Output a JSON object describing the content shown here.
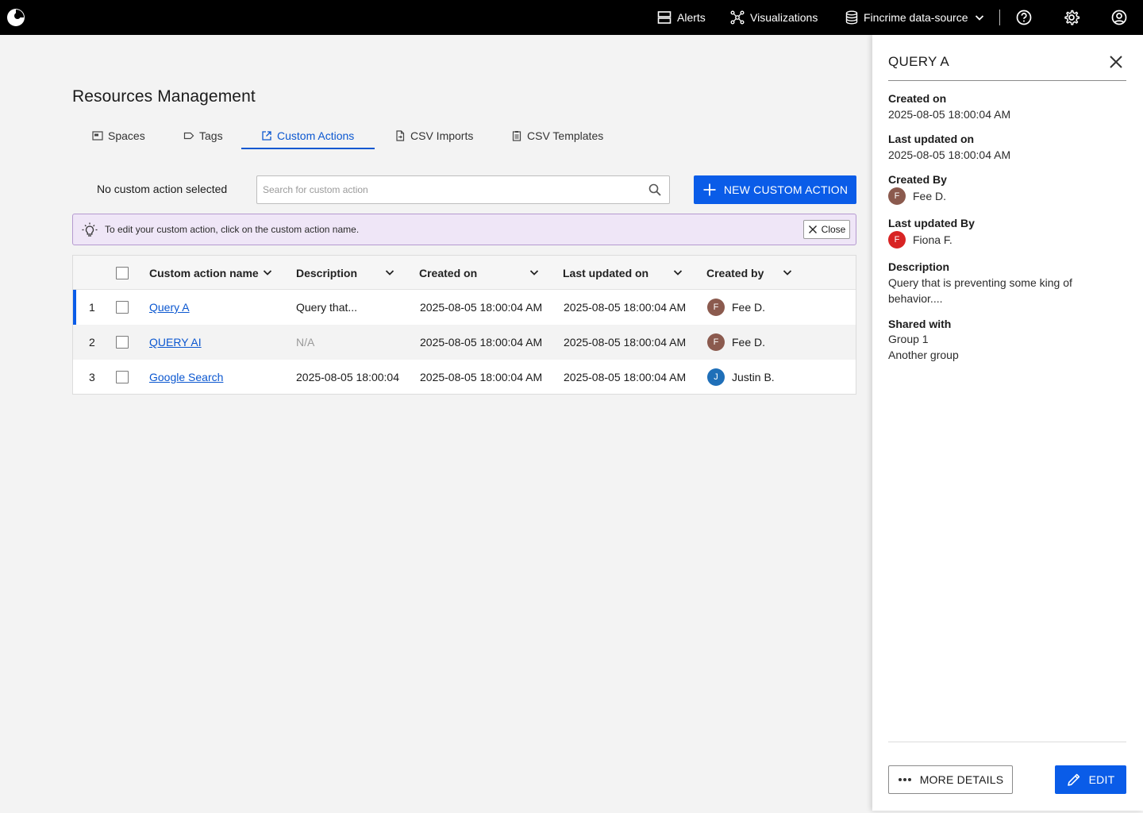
{
  "topbar": {
    "nav": {
      "alerts": "Alerts",
      "visualizations": "Visualizations",
      "datasource": "Fincrime data-source"
    },
    "icons": [
      "logo-icon",
      "alerts-icon",
      "visualizations-icon",
      "database-icon",
      "chevron-down-icon",
      "help-icon",
      "gear-icon",
      "account-icon"
    ]
  },
  "page": {
    "title": "Resources Management"
  },
  "tabs": [
    {
      "label": "Spaces",
      "icon": "space-icon",
      "active": false
    },
    {
      "label": "Tags",
      "icon": "tag-icon",
      "active": false
    },
    {
      "label": "Custom Actions",
      "icon": "external-link-icon",
      "active": true
    },
    {
      "label": "CSV Imports",
      "icon": "file-import-icon",
      "active": false
    },
    {
      "label": "CSV Templates",
      "icon": "clipboard-icon",
      "active": false
    }
  ],
  "toolbar": {
    "selection_label": "No custom action selected",
    "search_placeholder": "Search for custom action",
    "search_value": "",
    "new_button_label": "NEW CUSTOM ACTION"
  },
  "banner": {
    "text": "To edit your custom action, click on the custom action name.",
    "close_label": "Close"
  },
  "table": {
    "columns": {
      "name": "Custom action name",
      "description": "Description",
      "created_on": "Created on",
      "last_updated_on": "Last updated on",
      "created_by": "Created by"
    },
    "rows": [
      {
        "index": "1",
        "name": "Query A",
        "description": "Query that...",
        "created_on": "2025-08-05 18:00:04 AM",
        "last_updated_on": "2025-08-05 18:00:04 AM",
        "created_by": "Fee D.",
        "initial": "F",
        "avatar_color": "#8b5a4e"
      },
      {
        "index": "2",
        "name": "QUERY AI",
        "description": "N/A",
        "created_on": "2025-08-05 18:00:04 AM",
        "last_updated_on": "2025-08-05 18:00:04 AM",
        "created_by": "Fee D.",
        "initial": "F",
        "avatar_color": "#8b5a4e"
      },
      {
        "index": "3",
        "name": "Google Search",
        "description": "2025-08-05 18:00:04",
        "created_on": "2025-08-05 18:00:04 AM",
        "last_updated_on": "2025-08-05 18:00:04 AM",
        "created_by": "Justin B.",
        "initial": "J",
        "avatar_color": "#1f6fb8"
      }
    ]
  },
  "panel": {
    "title": "QUERY A",
    "created_on_label": "Created on",
    "created_on": "2025-08-05 18:00:04 AM",
    "last_updated_on_label": "Last updated on",
    "last_updated_on": "2025-08-05 18:00:04 AM",
    "created_by_label": "Created By",
    "created_by": "Fee D.",
    "created_by_initial": "F",
    "created_by_color": "#8b5a4e",
    "last_updated_by_label": "Last updated By",
    "last_updated_by": "Fiona F.",
    "last_updated_by_initial": "F",
    "last_updated_by_color": "#d82424",
    "description_label": "Description",
    "description": "Query that is preventing some king of behavior....",
    "shared_with_label": "Shared with",
    "shared_with": [
      "Group 1",
      "Another group"
    ],
    "more_details_label": "MORE DETAILS",
    "edit_label": "EDIT"
  },
  "colors": {
    "accent": "#0a5ce8",
    "link": "#0b57d0",
    "banner_bg": "#efe6f7",
    "banner_border": "#b59ad0"
  }
}
